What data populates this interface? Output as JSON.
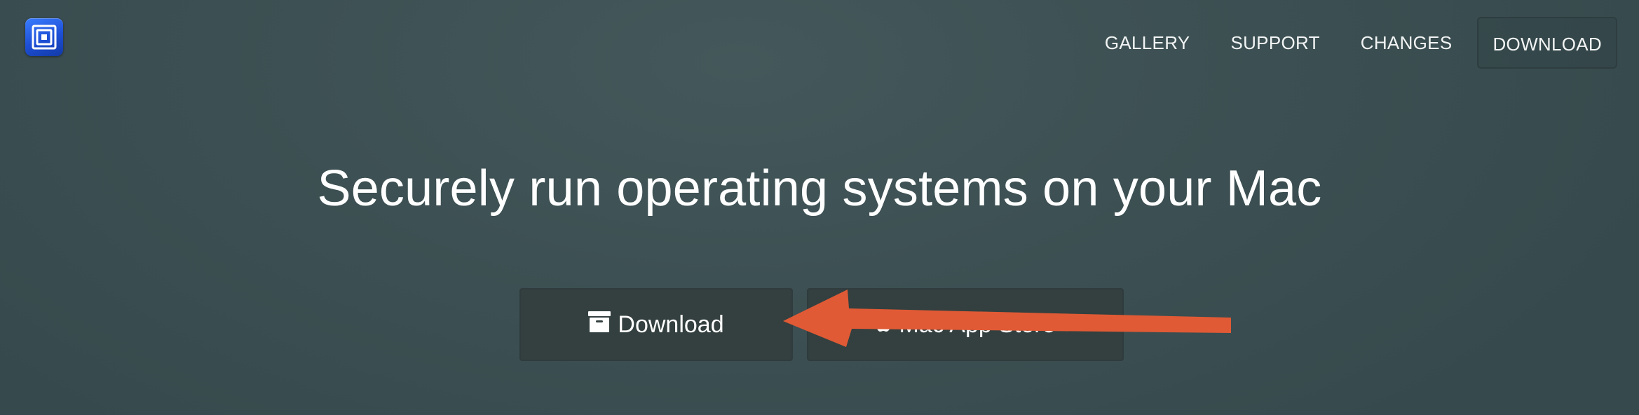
{
  "header": {
    "logo_icon": "app-logo-icon",
    "nav": {
      "gallery": "GALLERY",
      "support": "SUPPORT",
      "changes": "CHANGES",
      "download": "DOWNLOAD"
    }
  },
  "hero": {
    "headline": "Securely run operating systems on your Mac",
    "download_button": {
      "label": "Download",
      "icon": "archive-box-icon"
    },
    "app_store_button": {
      "label": "Mac App Store",
      "icon": "apple-icon"
    }
  },
  "annotation": {
    "type": "arrow",
    "color": "#e05a35",
    "points_to": "download_button"
  },
  "colors": {
    "background": "#3d5053",
    "button_background": "#33403f",
    "logo_blue": "#1d4fd6",
    "text": "#ffffff"
  }
}
